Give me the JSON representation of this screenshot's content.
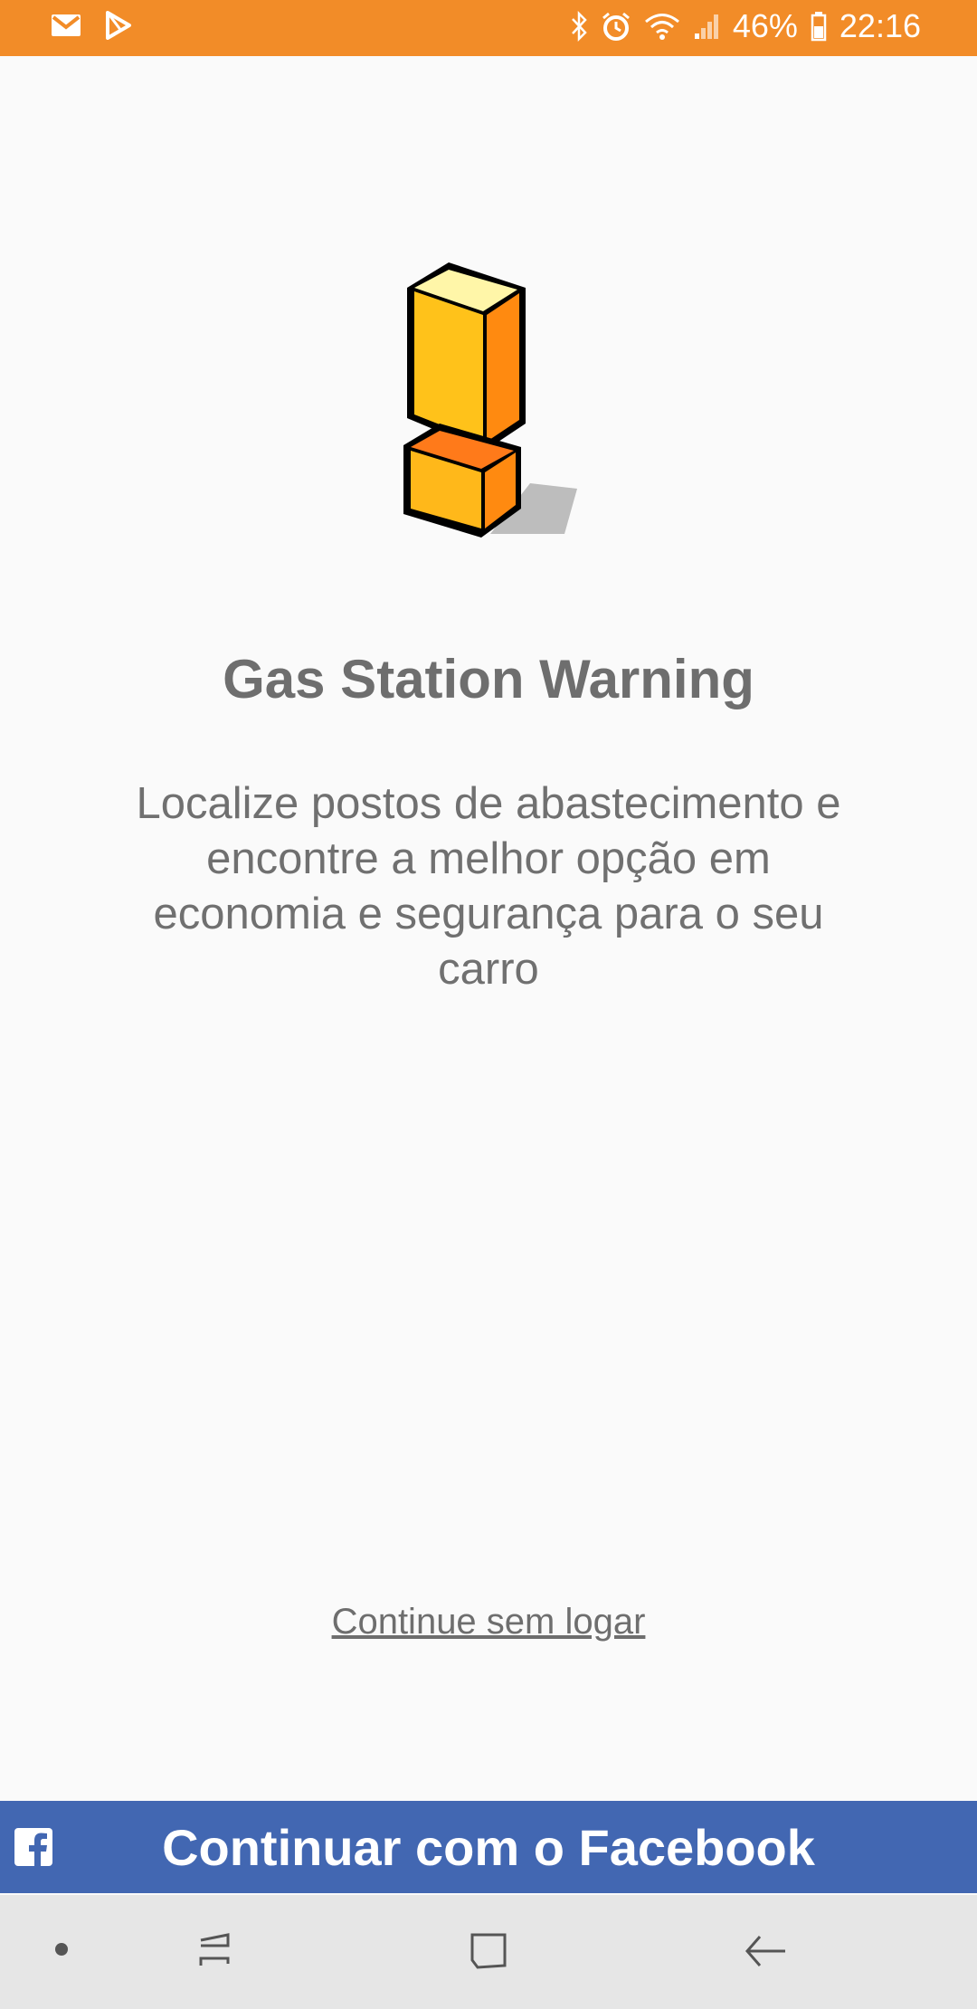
{
  "status_bar": {
    "battery": "46%",
    "time": "22:16",
    "icons": [
      "gmail-icon",
      "play-store-icon",
      "bluetooth-icon",
      "alarm-icon",
      "wifi-icon",
      "signal-icon",
      "battery-icon"
    ]
  },
  "app": {
    "title": "Gas Station Warning",
    "description": "Localize postos de abastecimento e encontre a melhor opção em economia e segurança para o seu carro",
    "skip_link": "Continue sem logar",
    "facebook_button": "Continuar com o Facebook"
  },
  "colors": {
    "status_bar": "#f28c28",
    "facebook": "#4267b2",
    "background": "#fafafa",
    "text": "#6e6e6e"
  },
  "nav_bar": {
    "icons": [
      "dot-icon",
      "recent-apps-icon",
      "home-icon",
      "back-icon"
    ]
  }
}
